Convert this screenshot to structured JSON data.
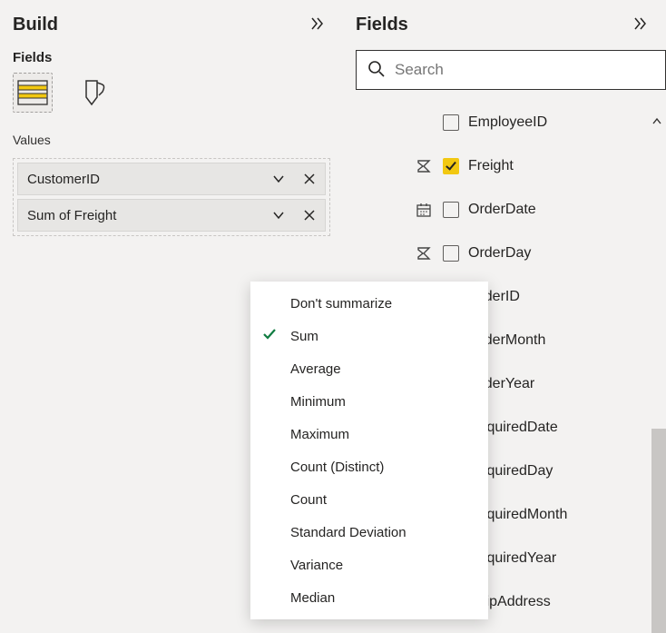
{
  "build": {
    "title": "Build",
    "fields_label": "Fields",
    "values_label": "Values",
    "pills": [
      {
        "label": "CustomerID"
      },
      {
        "label": "Sum of Freight"
      }
    ]
  },
  "fields": {
    "title": "Fields",
    "search_placeholder": "Search",
    "items": [
      {
        "name": "EmployeeID",
        "checked": false,
        "type": "none",
        "expand": true
      },
      {
        "name": "Freight",
        "checked": true,
        "type": "sigma"
      },
      {
        "name": "OrderDate",
        "checked": false,
        "type": "calendar"
      },
      {
        "name": "OrderDay",
        "checked": false,
        "type": "sigma"
      },
      {
        "name": "OrderID",
        "checked": false,
        "type": "none"
      },
      {
        "name": "OrderMonth",
        "checked": false,
        "type": "none"
      },
      {
        "name": "OrderYear",
        "checked": false,
        "type": "none"
      },
      {
        "name": "RequiredDate",
        "checked": false,
        "type": "none"
      },
      {
        "name": "RequiredDay",
        "checked": false,
        "type": "none"
      },
      {
        "name": "RequiredMonth",
        "checked": false,
        "type": "none"
      },
      {
        "name": "RequiredYear",
        "checked": false,
        "type": "none"
      },
      {
        "name": "ShipAddress",
        "checked": false,
        "type": "none"
      }
    ]
  },
  "context_menu": {
    "selected": "Sum",
    "items": [
      "Don't summarize",
      "Sum",
      "Average",
      "Minimum",
      "Maximum",
      "Count (Distinct)",
      "Count",
      "Standard Deviation",
      "Variance",
      "Median"
    ]
  }
}
